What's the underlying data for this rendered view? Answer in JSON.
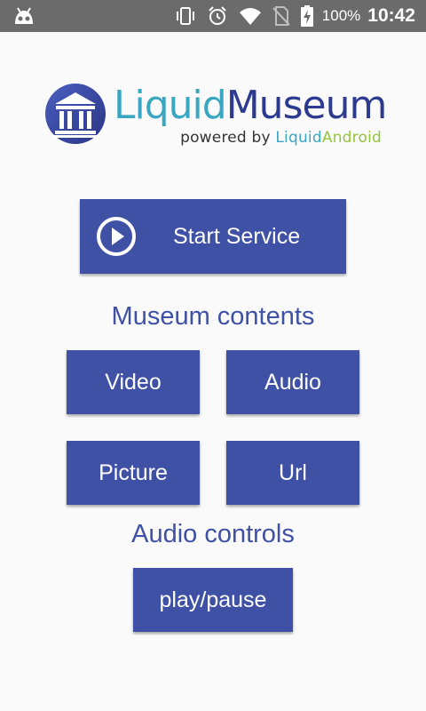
{
  "status_bar": {
    "battery_percent": "100%",
    "time": "10:42",
    "icons": [
      "android-debug-icon",
      "vibrate-icon",
      "alarm-icon",
      "wifi-icon",
      "no-sim-icon",
      "battery-charging-icon"
    ]
  },
  "logo": {
    "title_part1": "Liquid",
    "title_part2": "Museum",
    "subtitle_prefix": "powered by ",
    "subtitle_part1": "Liquid",
    "subtitle_part2": "Android",
    "icon": "museum-building-icon"
  },
  "buttons": {
    "start_service": "Start Service",
    "video": "Video",
    "audio": "Audio",
    "picture": "Picture",
    "url": "Url",
    "play_pause": "play/pause"
  },
  "sections": {
    "museum_contents": "Museum contents",
    "audio_controls": "Audio controls"
  },
  "colors": {
    "accent": "#3f51a5",
    "status_bar": "#6b6b6b",
    "background": "#fafafa",
    "logo_liquid": "#3aa7c2",
    "logo_museum": "#2c3a8f",
    "logo_android": "#95c43d"
  }
}
